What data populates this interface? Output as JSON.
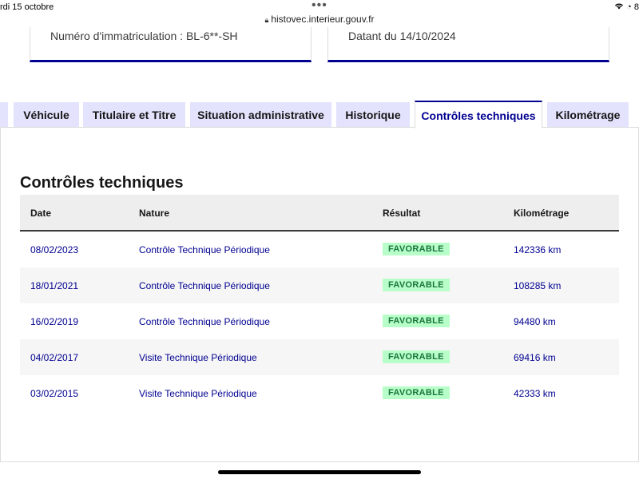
{
  "status_bar": {
    "time": "rdi 15 octobre",
    "right": "8"
  },
  "browser": {
    "url": "histovec.interieur.gouv.fr"
  },
  "cards": {
    "left": "Numéro d'immatriculation : BL-6**-SH",
    "right": "Datant du 14/10/2024"
  },
  "tabs": [
    {
      "label": "Véhicule",
      "active": false
    },
    {
      "label": "Titulaire et Titre",
      "active": false
    },
    {
      "label": "Situation administrative",
      "active": false
    },
    {
      "label": "Historique",
      "active": false
    },
    {
      "label": "Contrôles techniques",
      "active": true
    },
    {
      "label": "Kilométrage",
      "active": false
    }
  ],
  "section": {
    "title": "Contrôles techniques"
  },
  "table": {
    "headers": {
      "date": "Date",
      "nature": "Nature",
      "result": "Résultat",
      "km": "Kilométrage"
    },
    "rows": [
      {
        "date": "08/02/2023",
        "nature": "Contrôle Technique Périodique",
        "result": "FAVORABLE",
        "km": "142336 km"
      },
      {
        "date": "18/01/2021",
        "nature": "Contrôle Technique Périodique",
        "result": "FAVORABLE",
        "km": "108285 km"
      },
      {
        "date": "16/02/2019",
        "nature": "Contrôle Technique Périodique",
        "result": "FAVORABLE",
        "km": "94480 km"
      },
      {
        "date": "04/02/2017",
        "nature": "Visite Technique Périodique",
        "result": "FAVORABLE",
        "km": "69416 km"
      },
      {
        "date": "03/02/2015",
        "nature": "Visite Technique Périodique",
        "result": "FAVORABLE",
        "km": "42333 km"
      }
    ]
  },
  "colors": {
    "accent": "#000091",
    "tab_bg": "#e3e3fd",
    "success_text": "#18753c",
    "success_bg": "#b8fec9"
  }
}
